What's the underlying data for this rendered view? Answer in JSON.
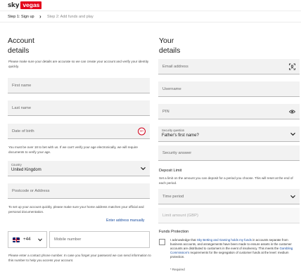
{
  "header": {
    "logo_sky": "sky",
    "logo_vegas": "vegas",
    "brand_color": "#e3001b"
  },
  "steps": {
    "step1": "Step 1: Sign up",
    "step2": "Step 2: Add funds and play",
    "chevron": "›"
  },
  "account": {
    "title_line1": "Account",
    "title_line2": "details",
    "intro": "Please make sure your details are accurate so we can create your account and verify your identity quickly.",
    "first_name_placeholder": "First name",
    "last_name_placeholder": "Last name",
    "dob_placeholder": "Date of birth",
    "age_badge": "18+",
    "age_note": "You must be over 18 to bet with us. If we can't verify your age electronically, we will require documents to verify your age.",
    "country_label": "Country",
    "country_value": "United Kingdom",
    "postcode_placeholder": "Postcode or Address",
    "address_note": "To set up your account quickly, please make sure your home address matches your official and personal documentation.",
    "enter_address_manually": "Enter address manually",
    "dial_code": "+44",
    "mobile_placeholder": "Mobile number",
    "phone_note": "Please enter a contact phone number. In case you forget your password we can send information to this number to help you access your account."
  },
  "your_details": {
    "title_line1": "Your",
    "title_line2": "details",
    "email_placeholder": "Email address",
    "username_placeholder": "Username",
    "pin_placeholder": "PIN",
    "security_question_label": "Security question",
    "security_question_value": "Father's first name?",
    "security_answer_placeholder": "Security answer"
  },
  "deposit_limit": {
    "heading": "Deposit Limit",
    "description": "Set a limit on the amount you can deposit for a period you choose. This will reset at the end of each period.",
    "time_period_placeholder": "Time period",
    "limit_amount_placeholder": "Limit amount (GBP)"
  },
  "funds_protection": {
    "heading": "Funds Protection",
    "text_a": "I acknowledge that ",
    "link_a": "Sky Betting and Gaming holds my funds",
    "text_b": " in accounts separate from business accounts, and arrangements have been made to ensure assets in the customer accounts are distributed to customers in the event of insolvency. This meets the ",
    "link_b": "Gambling Commission's",
    "text_c": " requirements for the segregation of customer funds at the level: medium protection.",
    "required": "* Required"
  },
  "icons": [
    "chevron-right-icon",
    "age-18-plus-icon",
    "chevron-down-icon",
    "id-scan-icon",
    "eye-icon",
    "uk-flag-icon"
  ]
}
